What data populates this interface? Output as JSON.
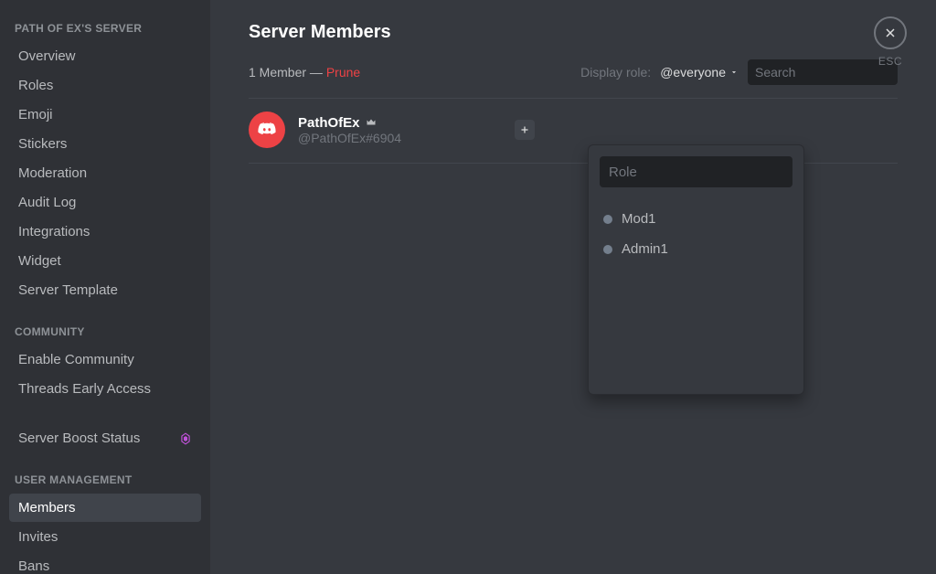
{
  "sidebar": {
    "heading_server": "PATH OF EX'S SERVER",
    "heading_community": "COMMUNITY",
    "heading_user_mgmt": "USER MANAGEMENT",
    "items": {
      "overview": "Overview",
      "roles": "Roles",
      "emoji": "Emoji",
      "stickers": "Stickers",
      "moderation": "Moderation",
      "audit_log": "Audit Log",
      "integrations": "Integrations",
      "widget": "Widget",
      "server_template": "Server Template",
      "enable_community": "Enable Community",
      "threads_early_access": "Threads Early Access",
      "server_boost_status": "Server Boost Status",
      "members": "Members",
      "invites": "Invites",
      "bans": "Bans"
    }
  },
  "header": {
    "title": "Server Members",
    "member_count_text": "1 Member —",
    "prune_label": "Prune",
    "display_role_label": "Display role:",
    "display_role_selected": "@everyone",
    "search_placeholder": "Search"
  },
  "member": {
    "name": "PathOfEx",
    "tag": "@PathOfEx#6904"
  },
  "role_picker": {
    "search_placeholder": "Role",
    "options": [
      "Mod1",
      "Admin1"
    ]
  },
  "close": {
    "esc": "ESC"
  }
}
